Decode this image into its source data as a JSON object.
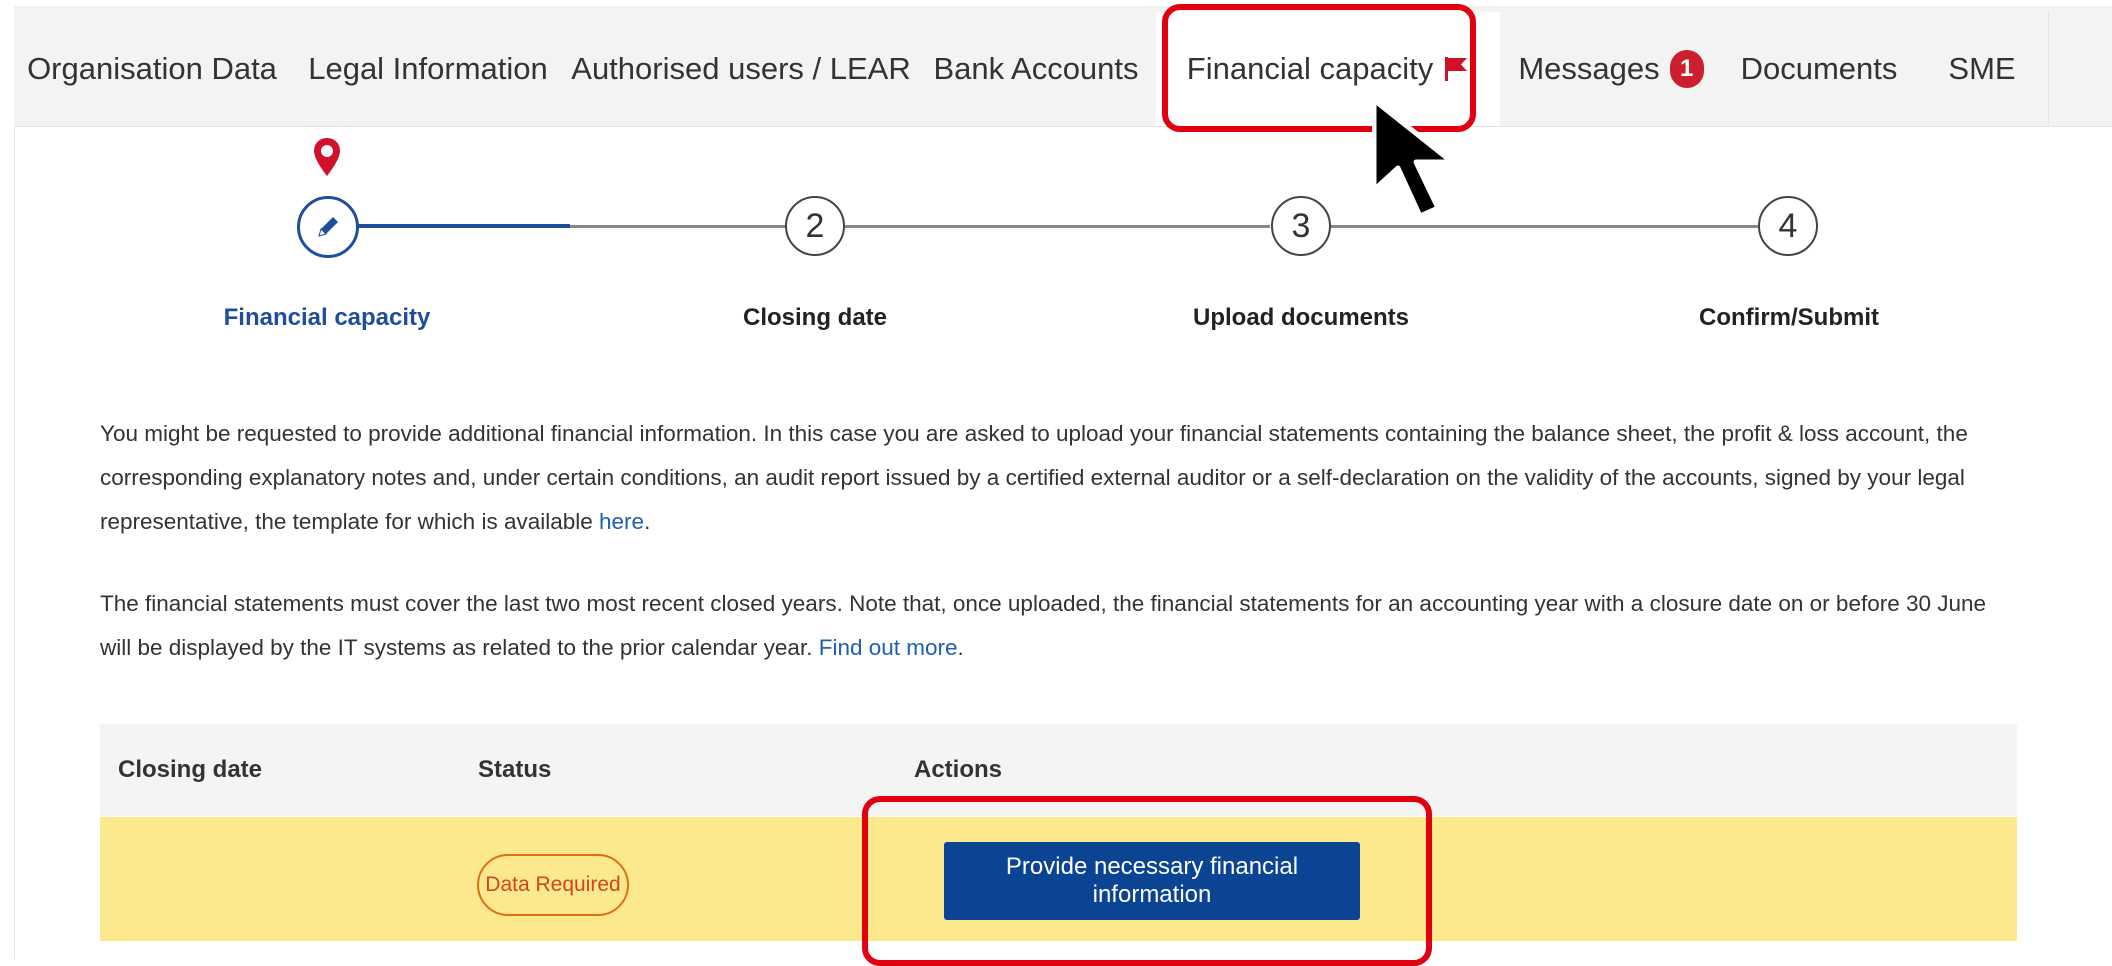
{
  "tabs": [
    {
      "label": "Organisation Data"
    },
    {
      "label": "Legal Information"
    },
    {
      "label": "Authorised users / LEAR"
    },
    {
      "label": "Bank Accounts"
    },
    {
      "label": "Financial capacity"
    },
    {
      "label": "Messages",
      "badge": "1"
    },
    {
      "label": "Documents"
    },
    {
      "label": "SME"
    }
  ],
  "stepper": {
    "steps": [
      {
        "label": "Financial capacity",
        "state": "current"
      },
      {
        "number": "2",
        "label": "Closing date"
      },
      {
        "number": "3",
        "label": "Upload documents"
      },
      {
        "number": "4",
        "label": "Confirm/Submit"
      }
    ]
  },
  "content": {
    "para1_text": "You might be requested to provide additional financial information. In this case you are asked to upload your financial statements containing the balance sheet, the profit & loss account, the corresponding explanatory notes and, under certain conditions, an audit report issued by a certified external auditor or a self-declaration on the validity of the accounts, signed by your legal representative, the template for which is available ",
    "para1_link": "here",
    "para1_end": ".",
    "para2_text": "The financial statements must cover the last two most recent closed years. Note that, once uploaded, the financial statements for an accounting year with a closure date on or before 30 June will be displayed by the IT systems as related to the prior calendar year. ",
    "para2_link": "Find out more",
    "para2_end": "."
  },
  "table": {
    "headers": [
      "Closing date",
      "Status",
      "Actions"
    ],
    "rows": [
      {
        "closing_date": "",
        "status": "Data Required",
        "action": "Provide necessary financial information"
      }
    ]
  },
  "colors": {
    "highlight": "#e00010",
    "primary": "#0c4494",
    "row_warning": "#fce98e",
    "badge_red": "#cc1f2d"
  }
}
